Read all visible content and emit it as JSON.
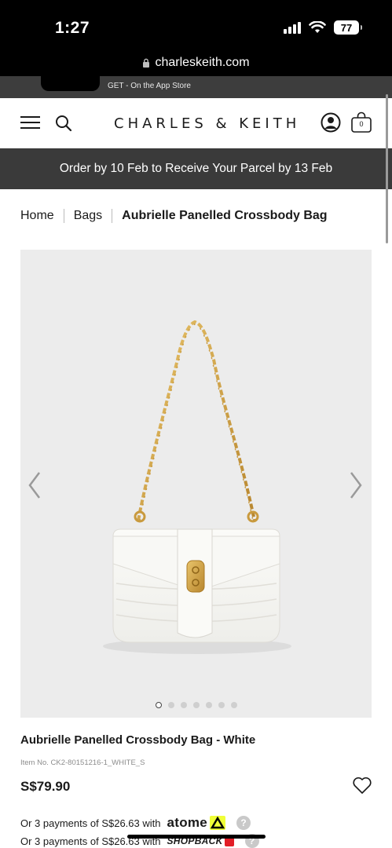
{
  "status_bar": {
    "time": "1:27",
    "battery": "77"
  },
  "url_bar": {
    "domain": "charleskeith.com"
  },
  "app_banner": {
    "text": "GET - On the App Store"
  },
  "header": {
    "brand": "CHARLES & KEITH",
    "bag_count": "0"
  },
  "promo": {
    "text": "Order by 10 Feb to Receive Your Parcel by 13 Feb"
  },
  "breadcrumb": {
    "items": [
      "Home",
      "Bags",
      "Aubrielle Panelled Crossbody Bag"
    ]
  },
  "gallery": {
    "image_count": 7,
    "active_index": 0
  },
  "product": {
    "title": "Aubrielle Panelled Crossbody Bag - White",
    "item_no": "Item No. CK2-80151216-1_WHITE_S",
    "price": "S$79.90"
  },
  "payments": [
    {
      "text": "Or 3 payments of S$26.63 with",
      "provider": "atome",
      "help": "?"
    },
    {
      "text": "Or 3 payments of S$26.63 with",
      "provider": "SHOPBACK",
      "help": "?"
    }
  ],
  "colors": {
    "promo_bg": "#3a3a3a",
    "gallery_bg": "#ececec",
    "atome_accent": "#f0ff37",
    "shopback_red": "#e21d26"
  }
}
